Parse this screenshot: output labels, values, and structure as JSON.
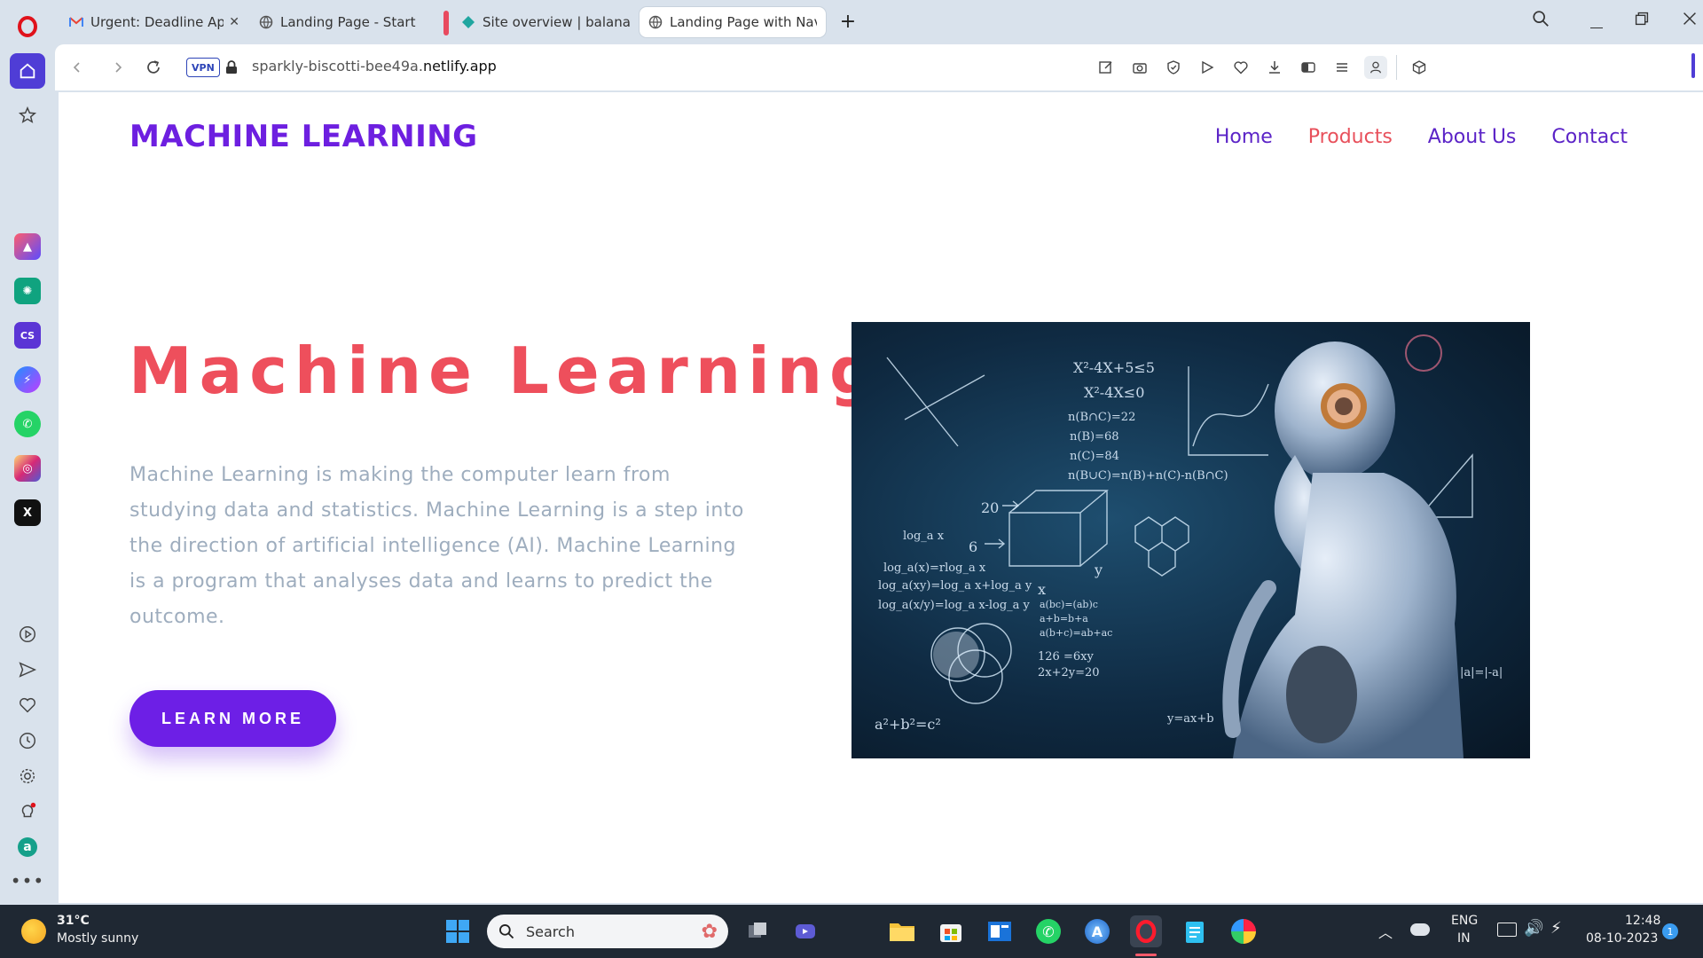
{
  "browser": {
    "tabs": [
      {
        "title": "Urgent: Deadline App",
        "favicon": "gmail-icon"
      },
      {
        "title": "Landing Page - Start Boot",
        "favicon": "globe-icon"
      },
      {
        "title": "Site overview | balananuji",
        "favicon": "netlify-icon"
      },
      {
        "title": "Landing Page with Nav M",
        "favicon": "globe-icon"
      }
    ],
    "vpn_label": "VPN",
    "url_prefix": "sparkly-biscotti-bee49a.",
    "url_domain": "netlify.app"
  },
  "site": {
    "logo": "MACHINE LEARNING",
    "nav": {
      "home": "Home",
      "products": "Products",
      "about": "About Us",
      "contact": "Contact"
    },
    "hero": {
      "title": "Machine Learning",
      "text": "Machine Learning is making the computer learn from studying data and statistics. Machine Learning is a step into the direction of artificial intelligence (AI). Machine Learning is a program that analyses data and learns to predict the outcome.",
      "button": "LEARN MORE"
    },
    "image_formulas": {
      "f1": "X²-4X+5≤5",
      "f2": "X²-4X≤0",
      "f3": "n(B∩C)=22",
      "f4": "n(B)=68",
      "f5": "n(C)=84",
      "f6": "n(B∪C)=n(B)+n(C)-n(B∩C)",
      "f7": "log_a x",
      "f8": "log_a(x)=rlog_a x",
      "f9": "log_a(xy)=log_a x+log_a y",
      "f10": "log_a(x/y)=log_a x-log_a y",
      "f11": "a(bc)=(ab)c",
      "f12": "a+b=b+a",
      "f13": "a(b+c)=ab+ac",
      "f14": "126 =6xy",
      "f15": "2x+2y=20",
      "f16": "a²+b²=c²",
      "f17": "y=ax+b",
      "f18": "20",
      "f19": "6",
      "f20": "x",
      "f21": "y",
      "f22": "|a|=|-a|"
    }
  },
  "taskbar": {
    "temperature": "31°C",
    "weather": "Mostly sunny",
    "search_placeholder": "Search",
    "language": "ENG",
    "region": "IN",
    "time": "12:48",
    "date": "08-10-2023",
    "notification_count": "1"
  },
  "colors": {
    "logo": "#6d1fe0",
    "nav": "#5b23c7",
    "nav_active": "#e8505b",
    "hero_title": "#ee4f5c",
    "hero_text": "#9eadbe",
    "button": "#6d1fe6",
    "opera_red": "#e0121b"
  }
}
